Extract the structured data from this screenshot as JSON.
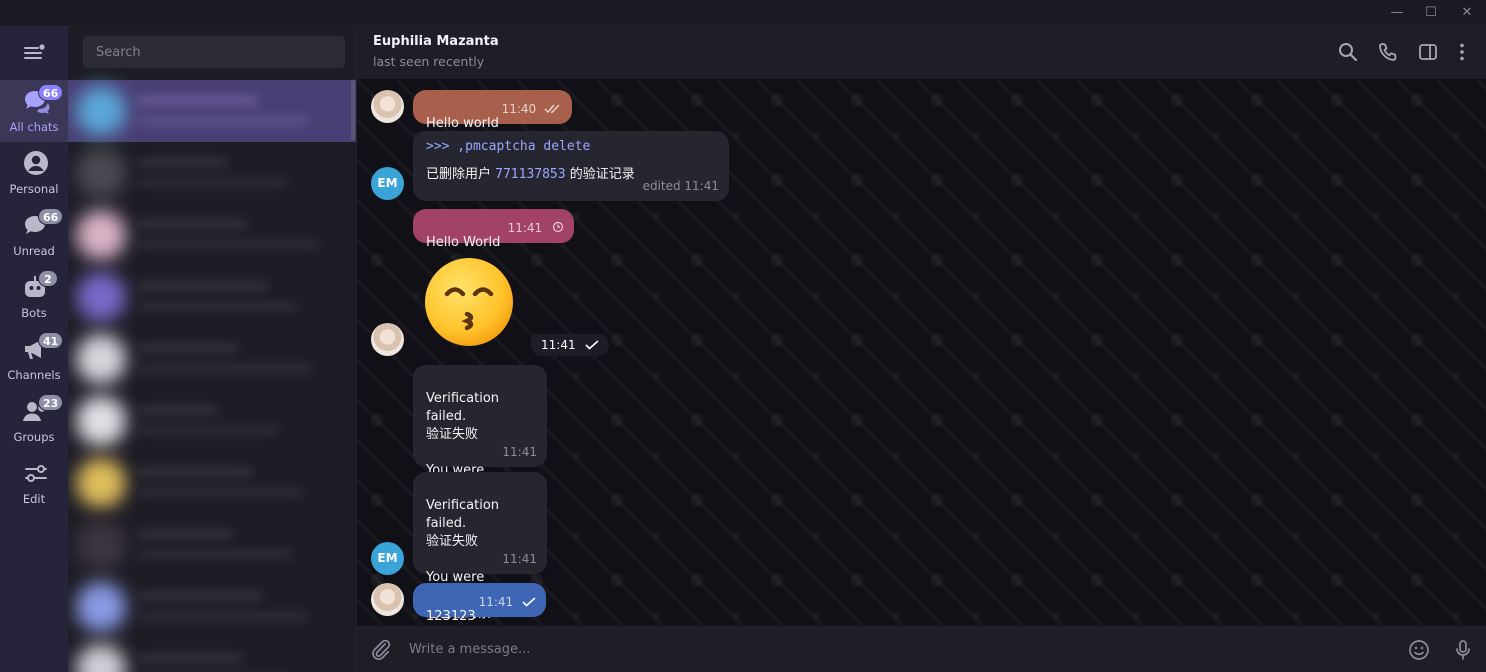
{
  "window": {
    "minimize": "—",
    "maximize": "☐",
    "close": "✕"
  },
  "sidebar": {
    "search_placeholder": "Search",
    "folders": [
      {
        "label": "All chats",
        "badge": "66",
        "active": true
      },
      {
        "label": "Personal",
        "badge": ""
      },
      {
        "label": "Unread",
        "badge": "66"
      },
      {
        "label": "Bots",
        "badge": "2"
      },
      {
        "label": "Channels",
        "badge": "41"
      },
      {
        "label": "Groups",
        "badge": "23"
      },
      {
        "label": "Edit",
        "badge": ""
      }
    ]
  },
  "header": {
    "name": "Euphilia Mazanta",
    "status": "last seen recently",
    "icons": [
      "search-icon",
      "phone-icon",
      "sidebar-toggle-icon",
      "more-vert-icon"
    ]
  },
  "messages": [
    {
      "text": "Hello world",
      "time": "11:40",
      "status": "read",
      "color": "#a8604c"
    },
    {
      "command": ">>> ,pmcaptcha delete",
      "text_prefix": "已删除用户 ",
      "user_id": "771137853",
      "text_suffix": " 的验证记录",
      "edited": "edited 11:41",
      "sender": "EM"
    },
    {
      "text": "Hello World",
      "time": "11:41",
      "status": "pending",
      "color": "#a24266"
    },
    {
      "sticker": "kissing-face-emoji",
      "time": "11:41",
      "status": "sent"
    },
    {
      "text": "Verification failed.\n验证失败\n\nYou were blocked.\n您已被封禁",
      "time": "11:41"
    },
    {
      "text": "Verification failed.\n验证失败\n\nYou were blocked.\n您已被封禁",
      "time": "11:41",
      "sender": "EM"
    },
    {
      "text": "123123",
      "time": "11:41",
      "status": "sent",
      "color": "#3e66b4"
    }
  ],
  "composer": {
    "placeholder": "Write a message..."
  }
}
